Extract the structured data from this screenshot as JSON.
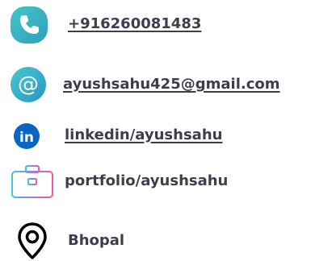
{
  "contacts": {
    "phone": {
      "icon": "phone-icon",
      "text": "+916260081483",
      "color": "#3bb6c4"
    },
    "email": {
      "icon": "at-sign-icon",
      "text": "ayushsahu425@gmail.com",
      "color": "#2fa3c9"
    },
    "linkedin": {
      "icon": "linkedin-icon",
      "text": "linkedin/ayushsahu",
      "color": "#0a66c2"
    },
    "portfolio": {
      "icon": "briefcase-icon",
      "text": "portfolio/ayushsahu",
      "color": "#ea4c89"
    },
    "location": {
      "icon": "location-pin-icon",
      "text": "Bhopal",
      "color": "#000000"
    }
  }
}
